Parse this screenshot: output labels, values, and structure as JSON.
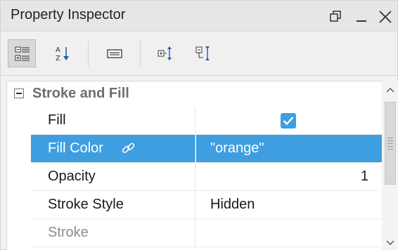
{
  "window": {
    "title": "Property Inspector",
    "controls": [
      "restore-icon",
      "minimize-icon",
      "close-icon"
    ]
  },
  "toolbar": {
    "buttons": [
      {
        "icon": "categorized-view-icon",
        "active": true
      },
      {
        "icon": "sort-alphabetical-icon",
        "active": false
      },
      {
        "icon": "property-pages-icon",
        "active": false
      },
      {
        "icon": "expand-all-icon",
        "active": false
      },
      {
        "icon": "collapse-all-icon",
        "active": false
      }
    ]
  },
  "grid": {
    "category": {
      "label": "Stroke and Fill",
      "expanded": true
    },
    "rows": [
      {
        "name": "Fill",
        "value_type": "checkbox",
        "checked": true
      },
      {
        "name": "Fill Color",
        "value": "\"orange\"",
        "selected": true,
        "linked": true
      },
      {
        "name": "Opacity",
        "value": "1"
      },
      {
        "name": "Stroke Style",
        "value": "Hidden"
      },
      {
        "name": "Stroke",
        "value": "",
        "dimmed": true
      }
    ]
  },
  "colors": {
    "selection": "#3e9ee0",
    "checkbox": "#3d9ee0",
    "toolbar_active": "#d9d9d9"
  }
}
